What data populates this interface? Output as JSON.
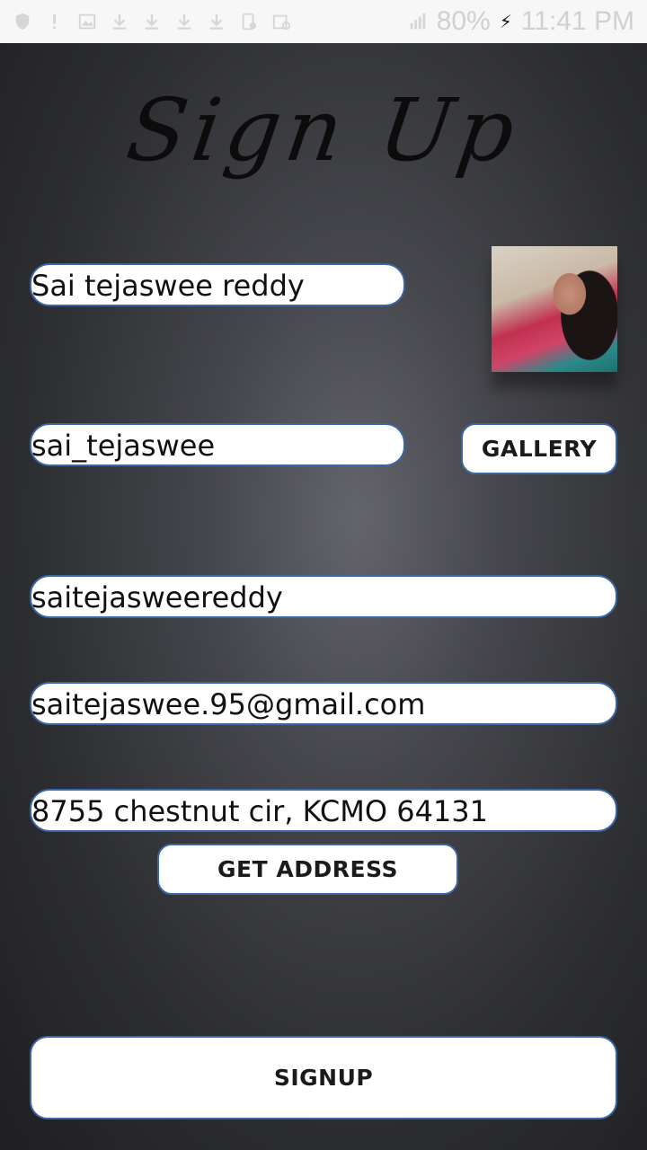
{
  "status_bar": {
    "battery_percent": "80%",
    "time": "11:41 PM",
    "icons": [
      "shield-icon",
      "notification-icon",
      "image-icon",
      "download-icon",
      "download-icon",
      "download-icon",
      "download-icon",
      "phone-icon",
      "image-edit-icon",
      "signal-icon",
      "charging-icon"
    ]
  },
  "title": "Sign Up",
  "profile_photo": {
    "icon": "profile-photo"
  },
  "form": {
    "name_value": "Sai tejaswee reddy",
    "username_value": "sai_tejaswee",
    "password_value": "saitejasweereddy",
    "email_value": "saitejaswee.95@gmail.com",
    "address_value": "8755 chestnut cir, KCMO 64131"
  },
  "buttons": {
    "gallery": "GALLERY",
    "get_address": "GET ADDRESS",
    "signup": "SIGNUP"
  },
  "colors": {
    "field_border": "#3a67a8",
    "field_background": "#ffffff",
    "background_center": "#64656b",
    "background_edge": "#1f1f22"
  }
}
